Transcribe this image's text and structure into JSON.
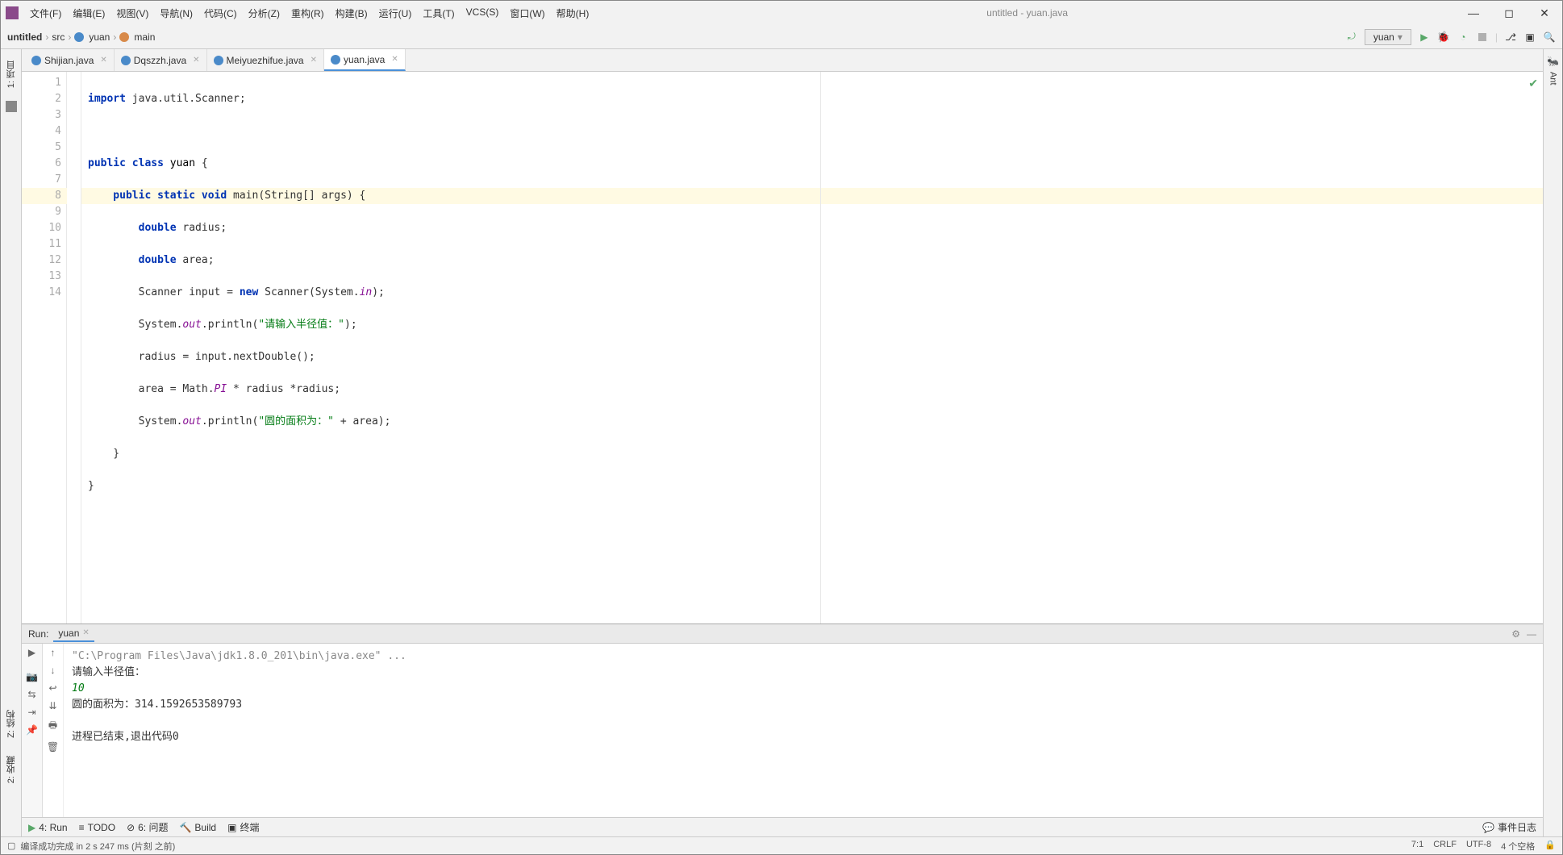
{
  "window": {
    "title": "untitled - yuan.java"
  },
  "menu": {
    "file": "文件(F)",
    "edit": "编辑(E)",
    "view": "视图(V)",
    "navigate": "导航(N)",
    "code": "代码(C)",
    "analyze": "分析(Z)",
    "refactor": "重构(R)",
    "build": "构建(B)",
    "run": "运行(U)",
    "tools": "工具(T)",
    "vcs": "VCS(S)",
    "window": "窗口(W)",
    "help": "帮助(H)"
  },
  "breadcrumb": {
    "project": "untitled",
    "src": "src",
    "pkg": "yuan",
    "method": "main"
  },
  "runconfig": {
    "name": "yuan"
  },
  "leftTool": {
    "project": "1: 项目",
    "favorites": "2: 收藏",
    "structure": "Z: 结构"
  },
  "rightTool": {
    "ant": "Ant"
  },
  "tabs": [
    {
      "label": "Shijian.java",
      "active": false
    },
    {
      "label": "Dqszzh.java",
      "active": false
    },
    {
      "label": "Meiyuezhifue.java",
      "active": false
    },
    {
      "label": "yuan.java",
      "active": true
    }
  ],
  "code": {
    "l1a": "import",
    "l1b": " java.util.Scanner;",
    "l3a": "public class ",
    "l3b": "yuan",
    "l3c": " {",
    "l4a": "    public static void ",
    "l4b": "main",
    "l4c": "(String[] args) {",
    "l5a": "        double ",
    "l5b": "radius;",
    "l6a": "        double ",
    "l6b": "area;",
    "l7a": "        Scanner input = ",
    "l7b": "new ",
    "l7c": "Scanner(System.",
    "l7d": "in",
    "l7e": ");",
    "l8a": "        System.",
    "l8b": "out",
    "l8c": ".println(",
    "l8d": "\"请输入半径值：\"",
    "l8e": ");",
    "l9": "        radius = input.nextDouble();",
    "l10a": "        area = Math.",
    "l10b": "PI",
    "l10c": " * radius *radius;",
    "l11a": "        System.",
    "l11b": "out",
    "l11c": ".println(",
    "l11d": "\"圆的面积为：\"",
    "l11e": " + area);",
    "l12": "    }",
    "l13": "}"
  },
  "lineNumbers": [
    "1",
    "2",
    "3",
    "4",
    "5",
    "6",
    "7",
    "8",
    "9",
    "10",
    "11",
    "12",
    "13",
    "14"
  ],
  "run": {
    "label": "Run:",
    "tab": "yuan",
    "cmd": "\"C:\\Program Files\\Java\\jdk1.8.0_201\\bin\\java.exe\" ...",
    "out1": "请输入半径值：",
    "input": "10",
    "out2": "圆的面积为：314.1592653589793",
    "exit": "进程已结束,退出代码0"
  },
  "bottom": {
    "run": "4: Run",
    "todo": "TODO",
    "problems": "6: 问题",
    "build": "Build",
    "terminal": "终端",
    "eventlog": "事件日志"
  },
  "status": {
    "msg": "编译成功完成 in 2 s 247 ms (片刻 之前)",
    "pos": "7:1",
    "le": "CRLF",
    "enc": "UTF-8",
    "indent": "4 个空格"
  }
}
